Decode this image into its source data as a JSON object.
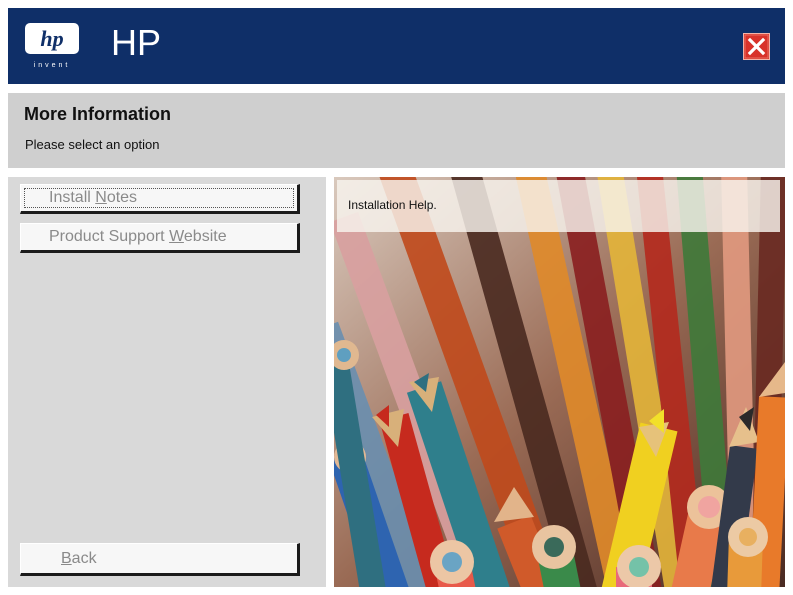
{
  "header": {
    "brand": "HP",
    "logo_text": "invent",
    "close_icon": "close-icon",
    "colors": {
      "bar": "#0f2f68",
      "close": "#d8322a"
    }
  },
  "info": {
    "title": "More Information",
    "subtitle": "Please select an option"
  },
  "options": [
    {
      "pre": "Install ",
      "key": "N",
      "post": "otes",
      "focused": true
    },
    {
      "pre": "Product Support ",
      "key": "W",
      "post": "ebsite",
      "focused": false
    }
  ],
  "back": {
    "pre": "",
    "key": "B",
    "post": "ack"
  },
  "preview": {
    "caption": "Installation Help."
  }
}
